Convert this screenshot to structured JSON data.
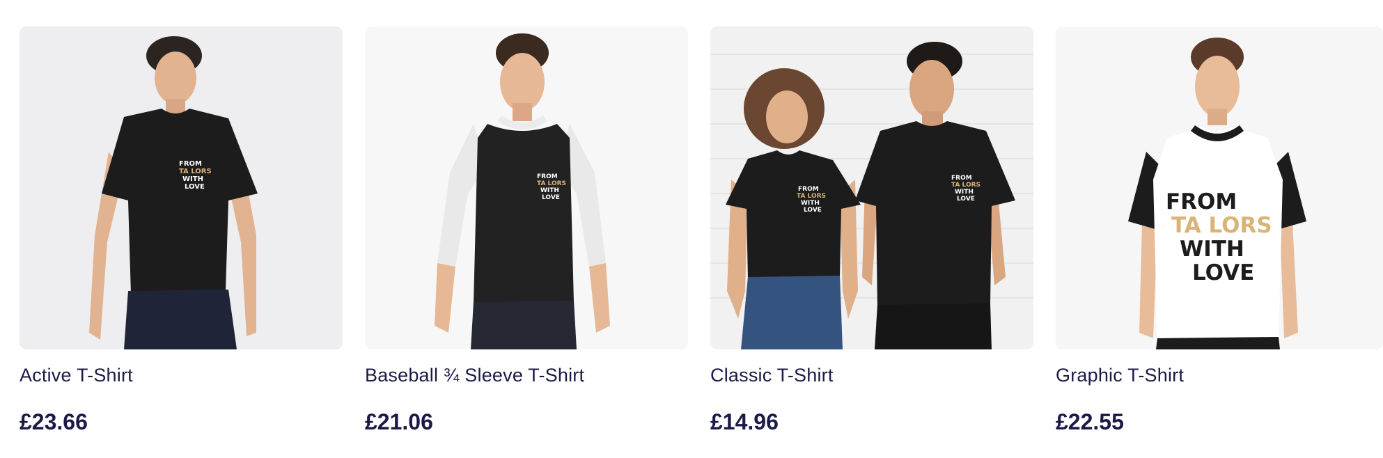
{
  "products": [
    {
      "title": "Active T-Shirt",
      "price": "£23.66",
      "image_icon": "active-tshirt-model-image",
      "print_lines": [
        "FROM",
        "TA LORS",
        "WITH",
        "LOVE"
      ]
    },
    {
      "title": "Baseball ¾ Sleeve T-Shirt",
      "price": "£21.06",
      "image_icon": "baseball-sleeve-tshirt-model-image",
      "print_lines": [
        "FROM",
        "TA LORS",
        "WITH",
        "LOVE"
      ]
    },
    {
      "title": "Classic T-Shirt",
      "price": "£14.96",
      "image_icon": "classic-tshirt-models-image",
      "print_lines": [
        "FROM",
        "TA LORS",
        "WITH",
        "LOVE"
      ]
    },
    {
      "title": "Graphic T-Shirt",
      "price": "£22.55",
      "image_icon": "graphic-tshirt-model-image",
      "print_lines": [
        "FROM",
        "TA LORS",
        "WITH",
        "LOVE"
      ]
    }
  ],
  "colors": {
    "text": "#1b1a47",
    "shirt_black": "#1c1c1c",
    "print_gold": "#d9b477",
    "print_white": "#ffffff",
    "skin": "#e2b391",
    "hair_dark": "#2b2420",
    "hair_brown": "#5a3a28",
    "denim": "#35537f"
  }
}
